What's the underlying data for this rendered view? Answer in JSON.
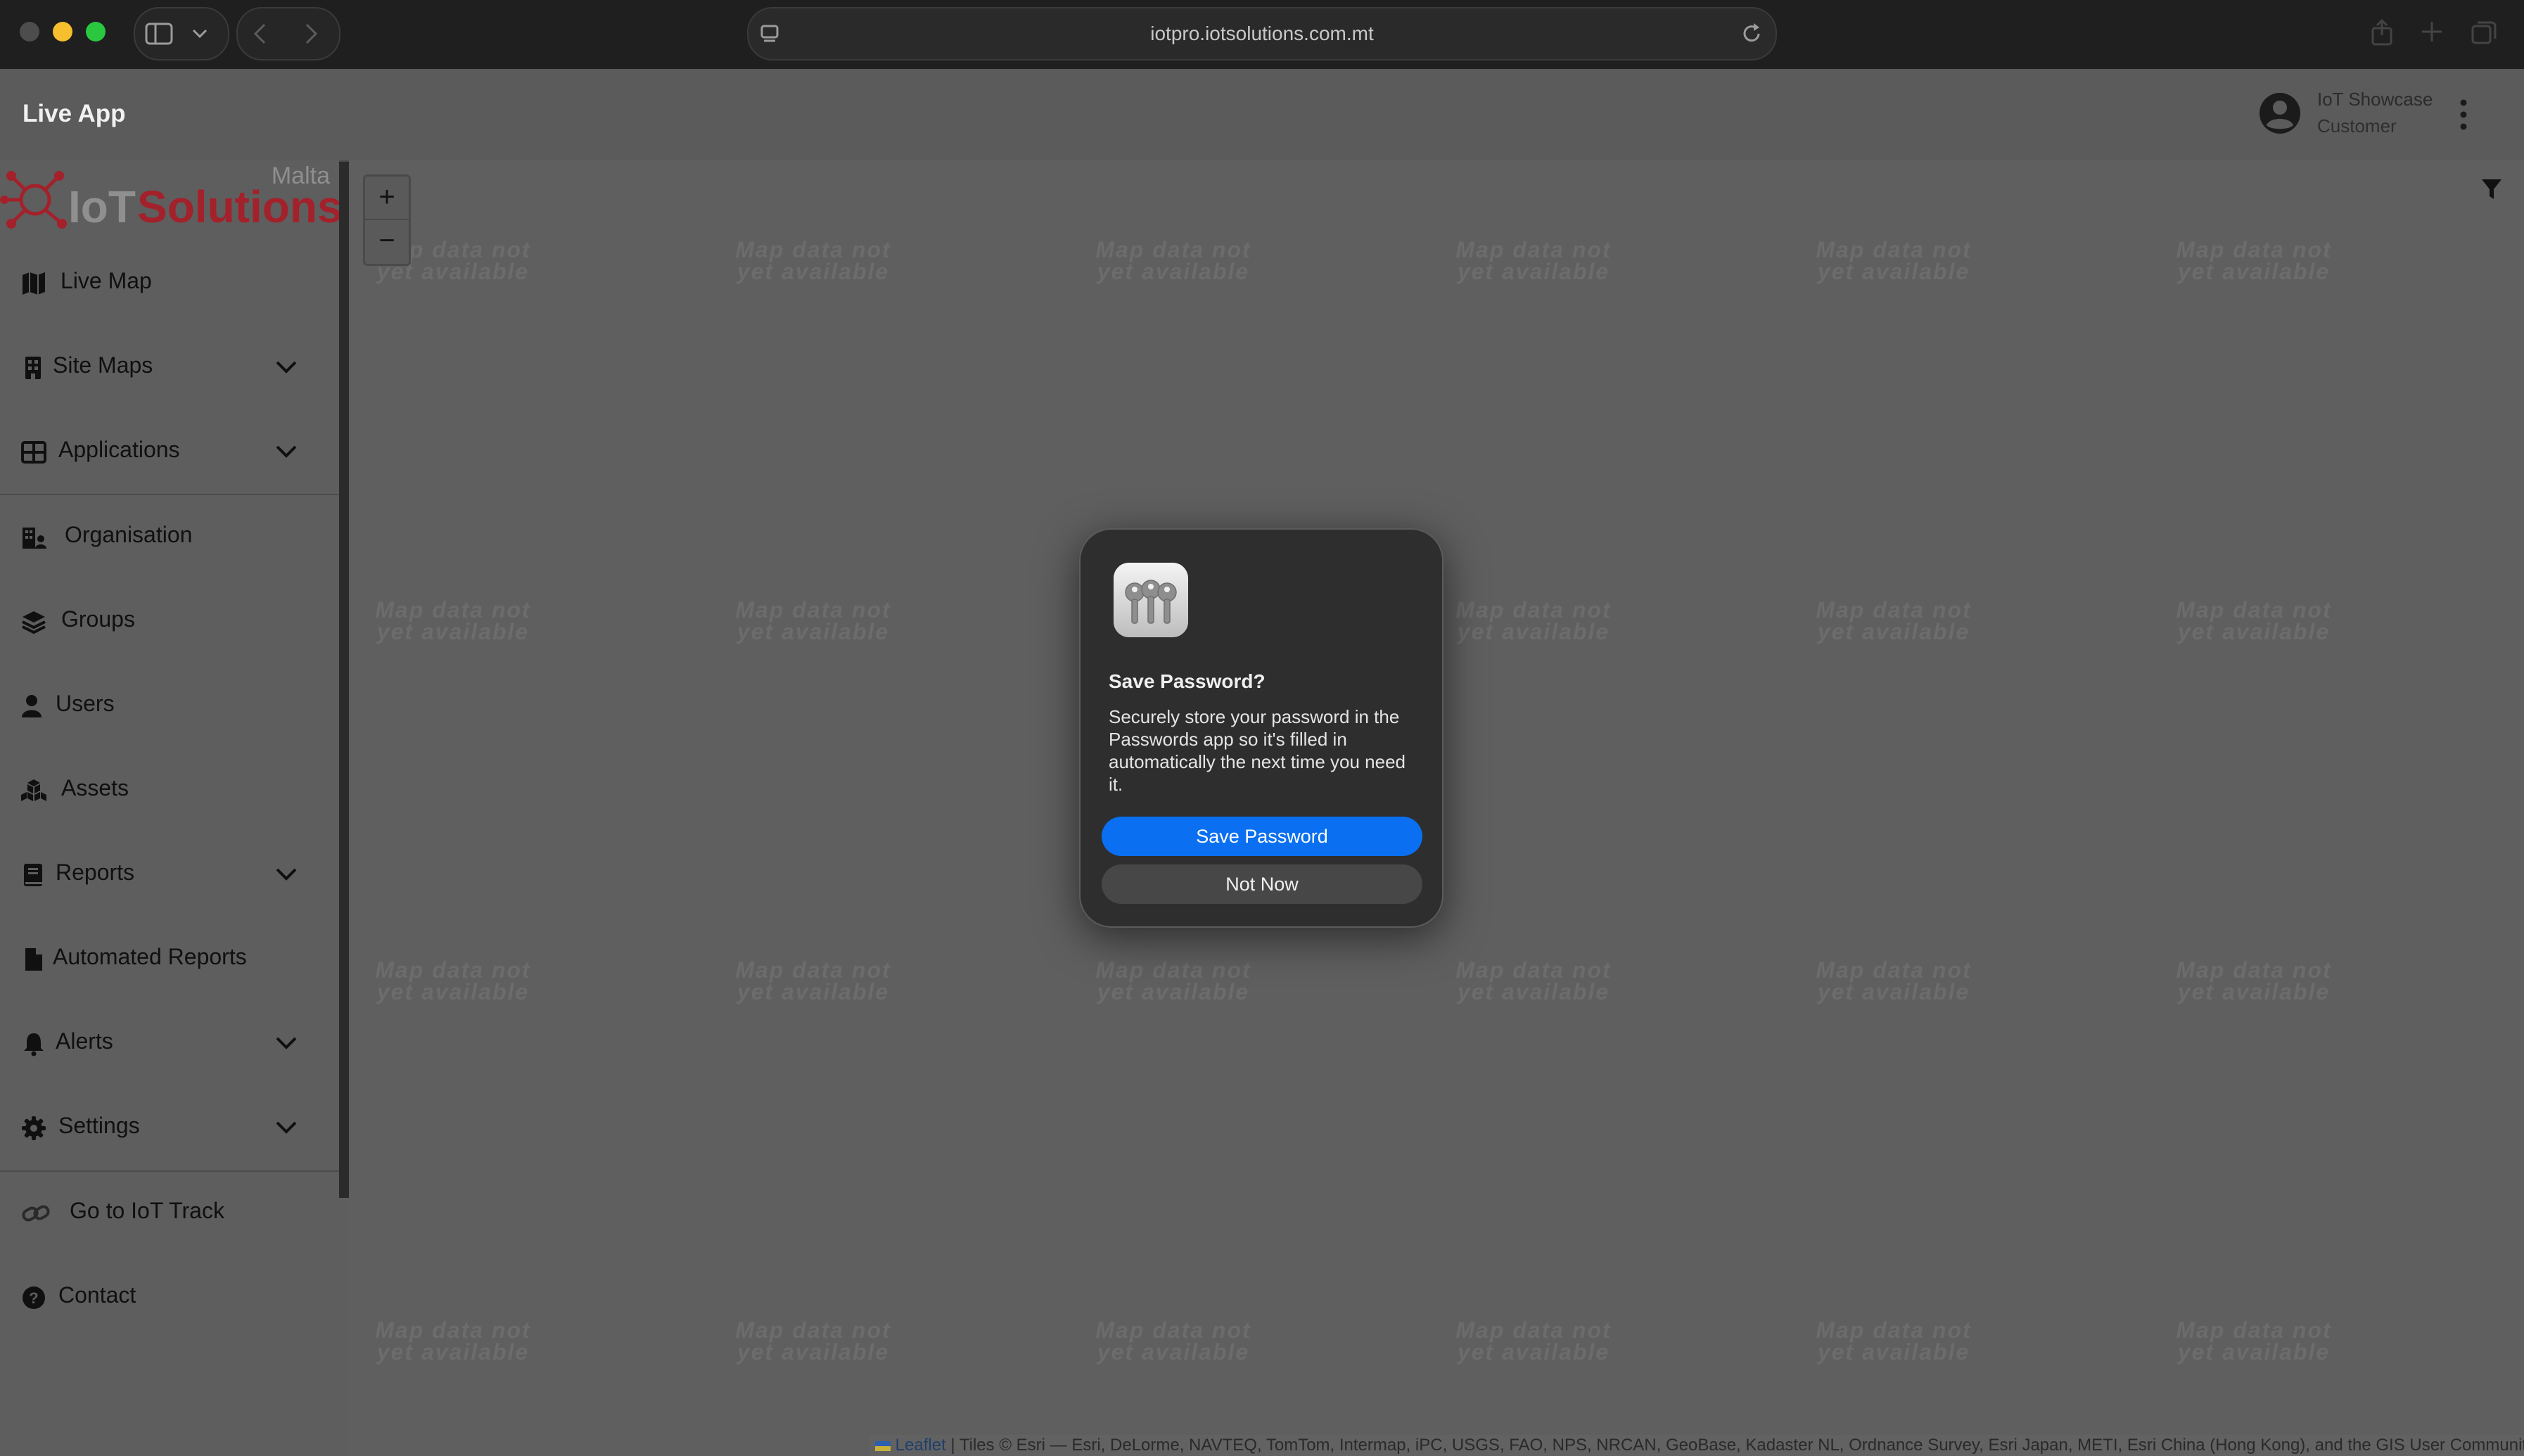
{
  "browser": {
    "url": "iotpro.iotsolutions.com.mt"
  },
  "app": {
    "title": "Live App",
    "user": {
      "name": "IoT Showcase",
      "role": "Customer"
    }
  },
  "logo": {
    "wordmark": "IoT Solutions",
    "region": "Malta",
    "colors": {
      "red": "#a3212a",
      "grey": "#8f8f8f"
    }
  },
  "sidebar": {
    "items": [
      {
        "label": "Live Map",
        "icon": "map-icon",
        "expandable": false
      },
      {
        "label": "Site Maps",
        "icon": "building-icon",
        "expandable": true
      },
      {
        "label": "Applications",
        "icon": "grid-icon",
        "expandable": true
      },
      {
        "label": "Organisation",
        "icon": "organisation-icon",
        "expandable": false
      },
      {
        "label": "Groups",
        "icon": "layers-icon",
        "expandable": false
      },
      {
        "label": "Users",
        "icon": "user-icon",
        "expandable": false
      },
      {
        "label": "Assets",
        "icon": "cubes-icon",
        "expandable": false
      },
      {
        "label": "Reports",
        "icon": "book-icon",
        "expandable": true
      },
      {
        "label": "Automated Reports",
        "icon": "file-icon",
        "expandable": false
      },
      {
        "label": "Alerts",
        "icon": "bell-icon",
        "expandable": true
      },
      {
        "label": "Settings",
        "icon": "gear-icon",
        "expandable": true
      },
      {
        "label": "Go to IoT Track",
        "icon": "link-icon",
        "expandable": false
      },
      {
        "label": "Contact",
        "icon": "help-icon",
        "expandable": false
      }
    ]
  },
  "map": {
    "tile_placeholder": [
      "Map data not",
      "yet available"
    ],
    "zoom_in": "+",
    "zoom_out": "−",
    "attribution": {
      "leaflet": "Leaflet",
      "tiles": " | Tiles © Esri — Esri, DeLorme, NAVTEQ, TomTom, Intermap, iPC, USGS, FAO, NPS, NRCAN, GeoBase, Kadaster NL, Ordnance Survey, Esri Japan, METI, Esri China (Hong Kong), and the GIS User Community"
    }
  },
  "dialog": {
    "icon": "passwords-keys-icon",
    "title": "Save Password?",
    "body": "Securely store your password in the Passwords app so it's filled in automatically the next time you need it.",
    "primary_button": "Save Password",
    "secondary_button": "Not Now",
    "accent": "#0a6ff0"
  }
}
